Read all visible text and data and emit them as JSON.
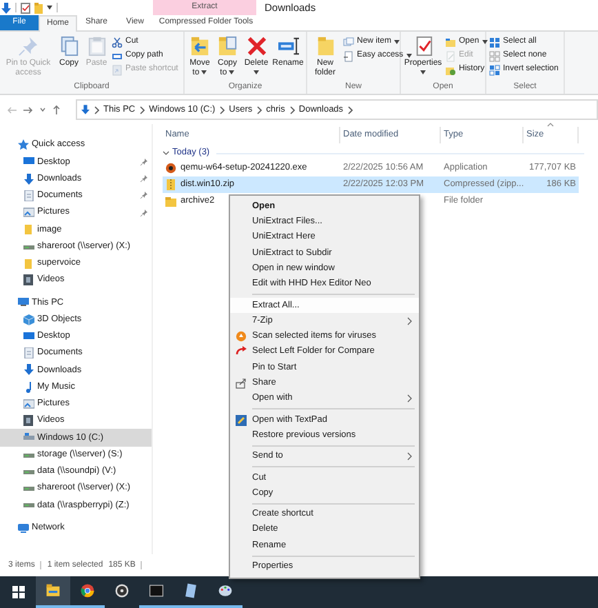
{
  "window": {
    "title": "Downloads",
    "contextual_tab": "Extract"
  },
  "ribbon_tabs": [
    {
      "label": "File",
      "kind": "file",
      "selected": false
    },
    {
      "label": "Home",
      "kind": "normal",
      "selected": true
    },
    {
      "label": "Share",
      "kind": "normal",
      "selected": false
    },
    {
      "label": "View",
      "kind": "normal",
      "selected": false
    },
    {
      "label": "Compressed Folder Tools",
      "kind": "contextual",
      "selected": false
    }
  ],
  "ribbon_groups": [
    {
      "label": "Clipboard",
      "commands": [
        {
          "label": "Pin to Quick access",
          "kind": "large",
          "disabled": true,
          "dropdown": false
        },
        {
          "label": "Copy",
          "kind": "large",
          "disabled": false,
          "dropdown": false
        },
        {
          "label": "Paste",
          "kind": "large",
          "disabled": true,
          "dropdown": false
        },
        {
          "label": "Cut",
          "kind": "small",
          "disabled": false,
          "dropdown": false
        },
        {
          "label": "Copy path",
          "kind": "small",
          "disabled": false,
          "dropdown": false
        },
        {
          "label": "Paste shortcut",
          "kind": "small",
          "disabled": true,
          "dropdown": false
        }
      ]
    },
    {
      "label": "Organize",
      "commands": [
        {
          "label": "Move to",
          "kind": "large",
          "disabled": false,
          "dropdown": true
        },
        {
          "label": "Copy to",
          "kind": "large",
          "disabled": false,
          "dropdown": true
        },
        {
          "label": "Delete",
          "kind": "large",
          "disabled": false,
          "dropdown": true
        },
        {
          "label": "Rename",
          "kind": "large",
          "disabled": false,
          "dropdown": false
        }
      ]
    },
    {
      "label": "New",
      "commands": [
        {
          "label": "New folder",
          "kind": "large",
          "disabled": false,
          "dropdown": false
        },
        {
          "label": "New item",
          "kind": "small",
          "disabled": false,
          "dropdown": true
        },
        {
          "label": "Easy access",
          "kind": "small",
          "disabled": false,
          "dropdown": true
        }
      ]
    },
    {
      "label": "Open",
      "commands": [
        {
          "label": "Properties",
          "kind": "large",
          "disabled": false,
          "dropdown": true
        },
        {
          "label": "Open",
          "kind": "small",
          "disabled": false,
          "dropdown": true
        },
        {
          "label": "Edit",
          "kind": "small",
          "disabled": true,
          "dropdown": false
        },
        {
          "label": "History",
          "kind": "small",
          "disabled": false,
          "dropdown": false
        }
      ]
    },
    {
      "label": "Select",
      "commands": [
        {
          "label": "Select all",
          "kind": "small",
          "disabled": false,
          "dropdown": false
        },
        {
          "label": "Select none",
          "kind": "small",
          "disabled": false,
          "dropdown": false
        },
        {
          "label": "Invert selection",
          "kind": "small",
          "disabled": false,
          "dropdown": false
        }
      ]
    }
  ],
  "address_bar": {
    "breadcrumbs": [
      "This PC",
      "Windows 10 (C:)",
      "Users",
      "chris",
      "Downloads"
    ]
  },
  "nav_pane": {
    "sections": [
      {
        "label": "Quick access",
        "kind": "quick_access",
        "items": [
          {
            "label": "Desktop",
            "kind": "desktop",
            "pinned": true,
            "selected": false
          },
          {
            "label": "Downloads",
            "kind": "downloads",
            "pinned": true,
            "selected": false
          },
          {
            "label": "Documents",
            "kind": "documents",
            "pinned": true,
            "selected": false
          },
          {
            "label": "Pictures",
            "kind": "pictures",
            "pinned": true,
            "selected": false
          },
          {
            "label": "image",
            "kind": "folder",
            "pinned": false,
            "selected": false
          },
          {
            "label": "shareroot (\\\\server) (X:)",
            "kind": "network_drive",
            "pinned": false,
            "selected": false
          },
          {
            "label": "supervoice",
            "kind": "folder",
            "pinned": false,
            "selected": false
          },
          {
            "label": "Videos",
            "kind": "videos",
            "pinned": false,
            "selected": false
          }
        ]
      },
      {
        "label": "This PC",
        "kind": "this_pc",
        "items": [
          {
            "label": "3D Objects",
            "kind": "objects3d",
            "pinned": false,
            "selected": false
          },
          {
            "label": "Desktop",
            "kind": "desktop",
            "pinned": false,
            "selected": false
          },
          {
            "label": "Documents",
            "kind": "documents",
            "pinned": false,
            "selected": false
          },
          {
            "label": "Downloads",
            "kind": "downloads",
            "pinned": false,
            "selected": false
          },
          {
            "label": "My Music",
            "kind": "music",
            "pinned": false,
            "selected": false
          },
          {
            "label": "Pictures",
            "kind": "pictures",
            "pinned": false,
            "selected": false
          },
          {
            "label": "Videos",
            "kind": "videos",
            "pinned": false,
            "selected": false
          },
          {
            "label": "Windows 10 (C:)",
            "kind": "drive",
            "pinned": false,
            "selected": true
          },
          {
            "label": "storage (\\\\server) (S:)",
            "kind": "network_drive",
            "pinned": false,
            "selected": false
          },
          {
            "label": "data (\\\\soundpi) (V:)",
            "kind": "network_drive",
            "pinned": false,
            "selected": false
          },
          {
            "label": "shareroot (\\\\server) (X:)",
            "kind": "network_drive",
            "pinned": false,
            "selected": false
          },
          {
            "label": "data (\\\\raspberrypi) (Z:)",
            "kind": "network_drive",
            "pinned": false,
            "selected": false
          }
        ]
      },
      {
        "label": "Network",
        "kind": "network"
      }
    ]
  },
  "file_list": {
    "columns": [
      "Name",
      "Date modified",
      "Type",
      "Size"
    ],
    "group": {
      "label": "Today (3)",
      "expanded": true
    },
    "rows": [
      {
        "name": "qemu-w64-setup-20241220.exe",
        "date": "2/22/2025 10:56 AM",
        "type": "Application",
        "size": "177,707 KB",
        "kind": "app",
        "selected": false
      },
      {
        "name": "dist.win10.zip",
        "date": "2/22/2025 12:03 PM",
        "type": "Compressed (zipp...",
        "size": "186 KB",
        "kind": "zip",
        "selected": true
      },
      {
        "name": "archive2",
        "type": "File folder",
        "kind": "folder",
        "selected": false
      }
    ]
  },
  "context_menu": {
    "items": [
      {
        "label": "Open",
        "kind": "default",
        "selected": false
      },
      {
        "label": "UniExtract Files...",
        "kind": "item",
        "selected": false
      },
      {
        "label": "UniExtract Here",
        "kind": "item",
        "selected": false
      },
      {
        "label": "UniExtract to Subdir",
        "kind": "item",
        "selected": false
      },
      {
        "label": "Open in new window",
        "kind": "item",
        "selected": false
      },
      {
        "label": "Edit with HHD Hex Editor Neo",
        "kind": "item",
        "selected": false
      },
      {
        "kind": "separator"
      },
      {
        "label": "Extract All...",
        "kind": "item",
        "selected": true
      },
      {
        "label": "7-Zip",
        "kind": "submenu",
        "selected": false
      },
      {
        "label": "Scan selected items for viruses",
        "kind": "item",
        "selected": false
      },
      {
        "label": "Select Left Folder for Compare",
        "kind": "item",
        "selected": false
      },
      {
        "label": "Pin to Start",
        "kind": "item",
        "selected": false
      },
      {
        "label": "Share",
        "kind": "item",
        "selected": false
      },
      {
        "label": "Open with",
        "kind": "submenu",
        "selected": false
      },
      {
        "kind": "separator"
      },
      {
        "label": "Open with TextPad",
        "kind": "item",
        "selected": false
      },
      {
        "label": "Restore previous versions",
        "kind": "item",
        "selected": false
      },
      {
        "kind": "separator"
      },
      {
        "label": "Send to",
        "kind": "submenu",
        "selected": false
      },
      {
        "kind": "separator"
      },
      {
        "label": "Cut",
        "kind": "item",
        "selected": false
      },
      {
        "label": "Copy",
        "kind": "item",
        "selected": false
      },
      {
        "kind": "separator"
      },
      {
        "label": "Create shortcut",
        "kind": "item",
        "selected": false
      },
      {
        "label": "Delete",
        "kind": "item",
        "selected": false
      },
      {
        "label": "Rename",
        "kind": "item",
        "selected": false
      },
      {
        "kind": "separator"
      },
      {
        "label": "Properties",
        "kind": "item",
        "selected": false
      }
    ]
  },
  "status_bar": {
    "item_count": "3 items",
    "selection": "1 item selected",
    "selection_size": "185 KB"
  },
  "taskbar": {
    "apps": [
      {
        "running": true,
        "active": true
      },
      {
        "running": true,
        "active": false
      },
      {
        "running": false,
        "active": false
      },
      {
        "running": true,
        "active": false
      },
      {
        "running": true,
        "active": false
      },
      {
        "running": true,
        "active": false
      }
    ]
  }
}
